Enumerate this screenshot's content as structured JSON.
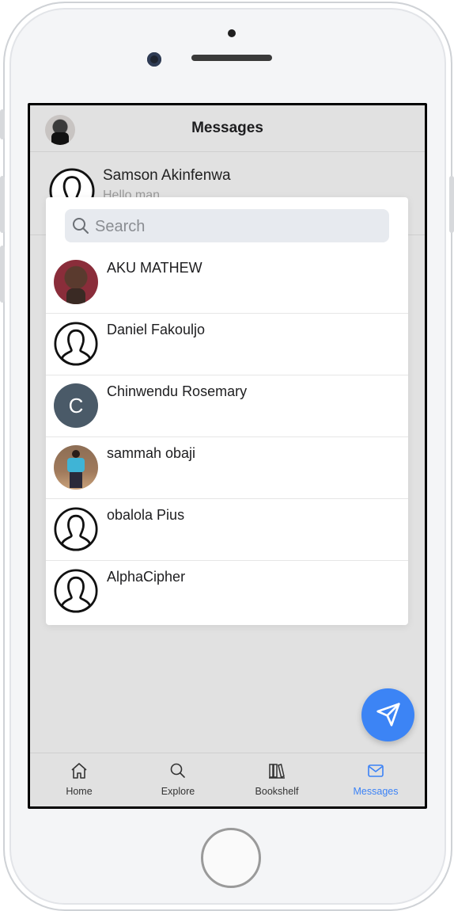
{
  "header": {
    "title": "Messages",
    "avatar_icon": "user-photo-avatar"
  },
  "conversation": {
    "name": "Samson Akinfenwa",
    "preview": "Hello man",
    "avatar_icon": "default-user-icon"
  },
  "search": {
    "placeholder": "Search",
    "value": "",
    "icon": "search-icon"
  },
  "results": [
    {
      "name": "AKU MATHEW",
      "avatar": "photo"
    },
    {
      "name": "Daniel Fakouljo",
      "avatar": "default-user-icon"
    },
    {
      "name": "Chinwendu Rosemary",
      "avatar": "letter",
      "letter": "C"
    },
    {
      "name": "sammah obaji",
      "avatar": "photo"
    },
    {
      "name": "obalola Pius",
      "avatar": "default-user-icon"
    },
    {
      "name": "AlphaCipher",
      "avatar": "default-user-icon"
    }
  ],
  "fab": {
    "icon": "send-icon",
    "color": "#3c84f5"
  },
  "tabs": [
    {
      "label": "Home",
      "icon": "home-icon",
      "active": false
    },
    {
      "label": "Explore",
      "icon": "search-icon",
      "active": false
    },
    {
      "label": "Bookshelf",
      "icon": "bookshelf-icon",
      "active": false
    },
    {
      "label": "Messages",
      "icon": "mail-icon",
      "active": true
    }
  ],
  "colors": {
    "accent": "#3b82f6",
    "background": "#e1e1e1"
  }
}
